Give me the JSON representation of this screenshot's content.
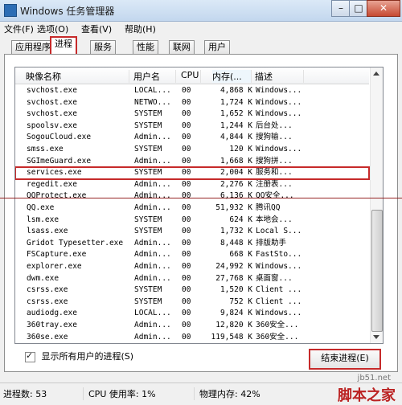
{
  "window": {
    "title": "Windows 任务管理器",
    "controls": {
      "minimize": "–",
      "maximize": "□",
      "close": "✕"
    }
  },
  "menu": [
    "文件(F)",
    "选项(O)",
    "查看(V)",
    "帮助(H)"
  ],
  "tabs": [
    "应用程序",
    "进程",
    "服务",
    "性能",
    "联网",
    "用户"
  ],
  "columns": {
    "name": "映像名称",
    "user": "用户名",
    "cpu": "CPU",
    "mem": "内存(...",
    "desc": "描述"
  },
  "processes": [
    {
      "name": "svchost.exe",
      "user": "LOCAL...",
      "cpu": "00",
      "mem": "4,868 K",
      "desc": "Windows..."
    },
    {
      "name": "svchost.exe",
      "user": "NETWO...",
      "cpu": "00",
      "mem": "1,724 K",
      "desc": "Windows..."
    },
    {
      "name": "svchost.exe",
      "user": "SYSTEM",
      "cpu": "00",
      "mem": "1,652 K",
      "desc": "Windows..."
    },
    {
      "name": "spoolsv.exe",
      "user": "SYSTEM",
      "cpu": "00",
      "mem": "1,244 K",
      "desc": "后台处..."
    },
    {
      "name": "SogouCloud.exe",
      "user": "Admin...",
      "cpu": "00",
      "mem": "4,844 K",
      "desc": "搜狗输..."
    },
    {
      "name": "smss.exe",
      "user": "SYSTEM",
      "cpu": "00",
      "mem": "120 K",
      "desc": "Windows..."
    },
    {
      "name": "SGImeGuard.exe",
      "user": "Admin...",
      "cpu": "00",
      "mem": "1,668 K",
      "desc": "搜狗拼..."
    },
    {
      "name": "services.exe",
      "user": "SYSTEM",
      "cpu": "00",
      "mem": "2,004 K",
      "desc": "服务和..."
    },
    {
      "name": "regedit.exe",
      "user": "Admin...",
      "cpu": "00",
      "mem": "2,276 K",
      "desc": "注册表..."
    },
    {
      "name": "QQProtect.exe",
      "user": "Admin...",
      "cpu": "00",
      "mem": "6,136 K",
      "desc": "QQ安全..."
    },
    {
      "name": "QQ.exe",
      "user": "Admin...",
      "cpu": "00",
      "mem": "51,932 K",
      "desc": "腾讯QQ"
    },
    {
      "name": "lsm.exe",
      "user": "SYSTEM",
      "cpu": "00",
      "mem": "624 K",
      "desc": "本地会..."
    },
    {
      "name": "lsass.exe",
      "user": "SYSTEM",
      "cpu": "00",
      "mem": "1,732 K",
      "desc": "Local S..."
    },
    {
      "name": "Gridot Typesetter.exe",
      "user": "Admin...",
      "cpu": "00",
      "mem": "8,448 K",
      "desc": "排版助手"
    },
    {
      "name": "FSCapture.exe",
      "user": "Admin...",
      "cpu": "00",
      "mem": "668 K",
      "desc": "FastSto..."
    },
    {
      "name": "explorer.exe",
      "user": "Admin...",
      "cpu": "00",
      "mem": "24,992 K",
      "desc": "Windows..."
    },
    {
      "name": "dwm.exe",
      "user": "Admin...",
      "cpu": "00",
      "mem": "27,768 K",
      "desc": "桌面窗..."
    },
    {
      "name": "csrss.exe",
      "user": "SYSTEM",
      "cpu": "00",
      "mem": "1,520 K",
      "desc": "Client ..."
    },
    {
      "name": "csrss.exe",
      "user": "SYSTEM",
      "cpu": "00",
      "mem": "752 K",
      "desc": "Client ..."
    },
    {
      "name": "audiodg.exe",
      "user": "LOCAL...",
      "cpu": "00",
      "mem": "9,824 K",
      "desc": "Windows..."
    },
    {
      "name": "360tray.exe",
      "user": "Admin...",
      "cpu": "00",
      "mem": "12,820 K",
      "desc": "360安全..."
    },
    {
      "name": "360se.exe",
      "user": "Admin...",
      "cpu": "00",
      "mem": "119,548 K",
      "desc": "360安全..."
    }
  ],
  "selected_index": 7,
  "show_all_users": "显示所有用户的进程(S)",
  "end_process": "结束进程(E)",
  "status": {
    "processes": "进程数: 53",
    "cpu": "CPU 使用率: 1%",
    "memory": "物理内存: 42%"
  },
  "watermark": {
    "url": "jb51.net",
    "brand": "脚本之家"
  },
  "colors": {
    "highlight_red": "#c62a2a"
  }
}
